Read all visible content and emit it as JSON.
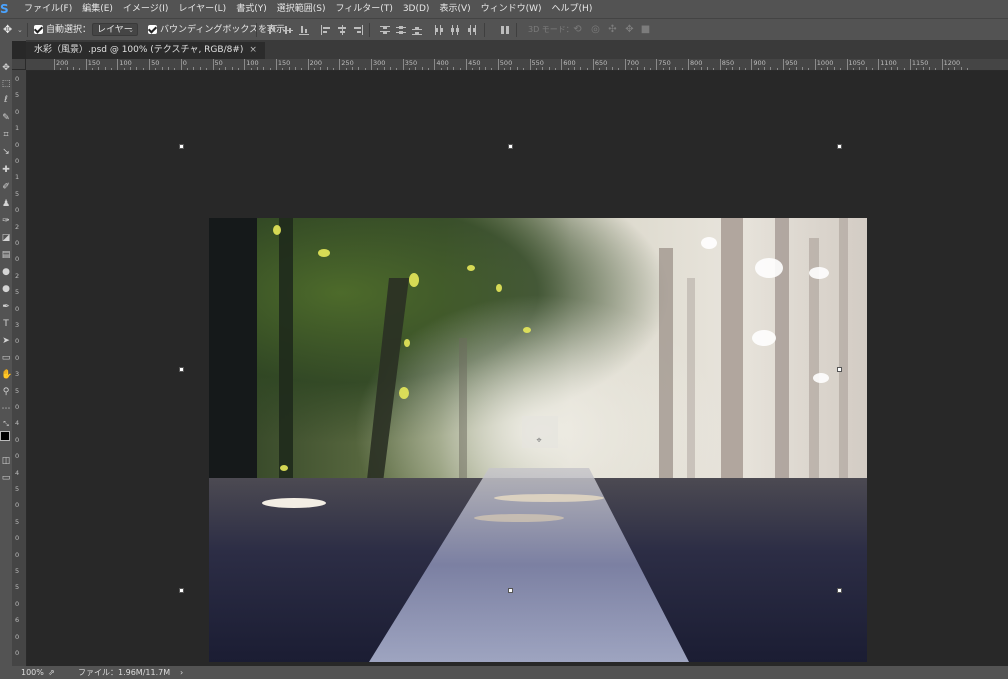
{
  "menubar": {
    "logo": "S",
    "items": [
      "ファイル(F)",
      "編集(E)",
      "イメージ(I)",
      "レイヤー(L)",
      "書式(Y)",
      "選択範囲(S)",
      "フィルター(T)",
      "3D(D)",
      "表示(V)",
      "ウィンドウ(W)",
      "ヘルプ(H)"
    ]
  },
  "options": {
    "move_tool_icon": "move-icon",
    "auto_select_label": "自動選択：",
    "auto_select_checked": true,
    "auto_select_target": "レイヤー",
    "bounding_box_label": "バウンディングボックスを表示",
    "bounding_box_checked": true,
    "mode_3d_label": "3D モード："
  },
  "document_tab": {
    "title": "水彩（風景）.psd @ 100% (テクスチャ, RGB/8#)",
    "close": "×"
  },
  "ruler": {
    "top_labels": [
      "200",
      "150",
      "100",
      "50",
      "0",
      "50",
      "100",
      "150",
      "200",
      "250",
      "300",
      "350",
      "400",
      "450",
      "500",
      "550",
      "600",
      "650",
      "700",
      "750",
      "800",
      "850",
      "900",
      "950",
      "1000",
      "1050",
      "1100",
      "1150",
      "1200"
    ],
    "left_labels": [
      "0",
      "5",
      "0",
      "1",
      "0",
      "0",
      "1",
      "5",
      "0",
      "2",
      "0",
      "0",
      "2",
      "5",
      "0",
      "3",
      "0",
      "0",
      "3",
      "5",
      "0",
      "4",
      "0",
      "0",
      "4",
      "5",
      "0",
      "5",
      "0",
      "0",
      "5",
      "5",
      "0",
      "6",
      "0",
      "0"
    ]
  },
  "status": {
    "zoom": "100%",
    "file_label": "ファイル：1.96M/11.7M",
    "arrow": "›"
  },
  "colors": {
    "chrome": "#535353",
    "workspace": "#282828",
    "accent": "#4aa3ff"
  }
}
